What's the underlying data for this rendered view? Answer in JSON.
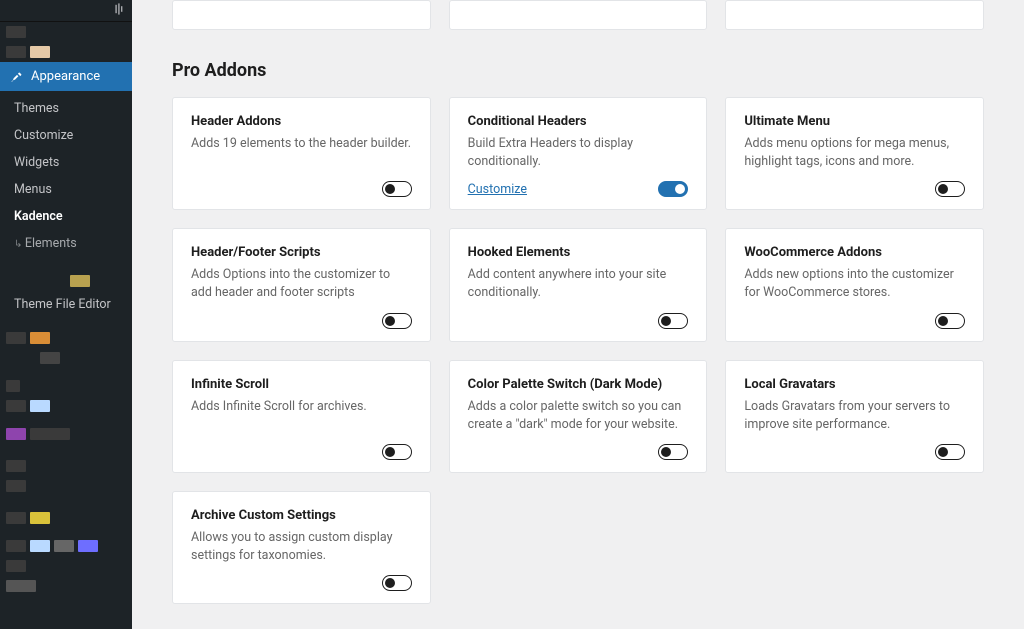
{
  "sidebar": {
    "active_menu": "Appearance",
    "submenu": [
      {
        "label": "Themes",
        "current": false
      },
      {
        "label": "Customize",
        "current": false
      },
      {
        "label": "Widgets",
        "current": false
      },
      {
        "label": "Menus",
        "current": false
      },
      {
        "label": "Kadence",
        "current": true
      },
      {
        "label": "Elements",
        "current": false,
        "indent": true
      },
      {
        "label": "Theme File Editor",
        "current": false,
        "gap": true
      }
    ]
  },
  "section_title": "Pro Addons",
  "cards": [
    {
      "title": "Header Addons",
      "desc": "Adds 19 elements to the header builder.",
      "link": null,
      "on": false
    },
    {
      "title": "Conditional Headers",
      "desc": "Build Extra Headers to display conditionally.",
      "link": "Customize",
      "on": true
    },
    {
      "title": "Ultimate Menu",
      "desc": "Adds menu options for mega menus, highlight tags, icons and more.",
      "link": null,
      "on": false
    },
    {
      "title": "Header/Footer Scripts",
      "desc": "Adds Options into the customizer to add header and footer scripts",
      "link": null,
      "on": false
    },
    {
      "title": "Hooked Elements",
      "desc": "Add content anywhere into your site conditionally.",
      "link": null,
      "on": false
    },
    {
      "title": "WooCommerce Addons",
      "desc": "Adds new options into the customizer for WooCommerce stores.",
      "link": null,
      "on": false
    },
    {
      "title": "Infinite Scroll",
      "desc": "Adds Infinite Scroll for archives.",
      "link": null,
      "on": false
    },
    {
      "title": "Color Palette Switch (Dark Mode)",
      "desc": "Adds a color palette switch so you can create a \"dark\" mode for your website.",
      "link": null,
      "on": false
    },
    {
      "title": "Local Gravatars",
      "desc": "Loads Gravatars from your servers to improve site performance.",
      "link": null,
      "on": false
    },
    {
      "title": "Archive Custom Settings",
      "desc": "Allows you to assign custom display settings for taxonomies.",
      "link": null,
      "on": false
    }
  ]
}
